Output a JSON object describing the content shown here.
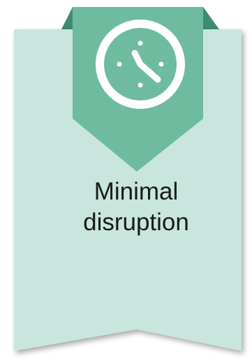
{
  "card": {
    "caption_line1": "Minimal",
    "caption_line2": "disruption",
    "icon": "clock-icon"
  },
  "colors": {
    "card_fill": "#c8e6de",
    "banner_fill": "#6fbba0",
    "banner_dark": "#3e8b70",
    "icon_stroke": "#ffffff",
    "text": "#1a1a1a"
  }
}
